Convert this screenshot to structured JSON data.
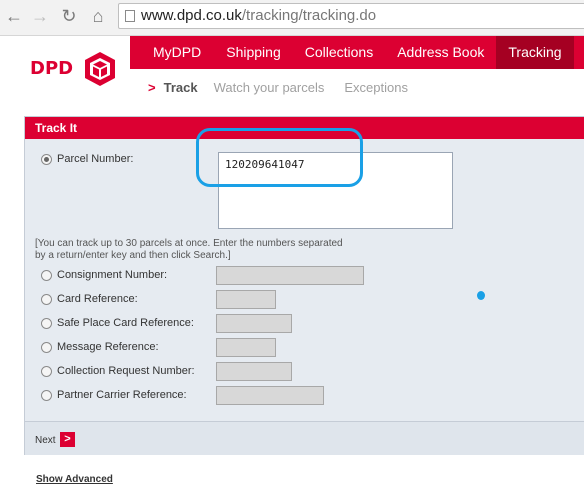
{
  "browser": {
    "url_host": "www.dpd.co.uk",
    "url_path": "/tracking/tracking.do",
    "icons": [
      "back-icon",
      "forward-icon",
      "reload-icon",
      "home-icon"
    ]
  },
  "header": {
    "logo_text": "DPD",
    "menu": [
      {
        "label": "MyDPD"
      },
      {
        "label": "Shipping"
      },
      {
        "label": "Collections"
      },
      {
        "label": "Address Book"
      },
      {
        "label": "Tracking"
      }
    ],
    "submenu": {
      "arrow": ">",
      "active": "Track",
      "items": [
        "Watch your parcels",
        "Exceptions"
      ]
    }
  },
  "track_it": {
    "title": "Track It",
    "parcel_label": "Parcel Number:",
    "parcel_value": "120209641047",
    "hint": "[You can track up to 30 parcels at once. Enter the numbers separated by a return/enter key and then click Search.]",
    "fields": [
      {
        "label": "Consignment Number:"
      },
      {
        "label": "Card Reference:"
      },
      {
        "label": "Safe Place Card Reference:"
      },
      {
        "label": "Message Reference:"
      },
      {
        "label": "Collection Request Number:"
      },
      {
        "label": "Partner Carrier Reference:"
      }
    ],
    "next_label": "Next",
    "next_icon": ">",
    "show_advanced": "Show Advanced"
  },
  "colors": {
    "brand_red": "#dc0032",
    "active_tab": "#a50022",
    "panel_bg": "#e6ebf1",
    "annotation_blue": "#1aa0e6"
  }
}
